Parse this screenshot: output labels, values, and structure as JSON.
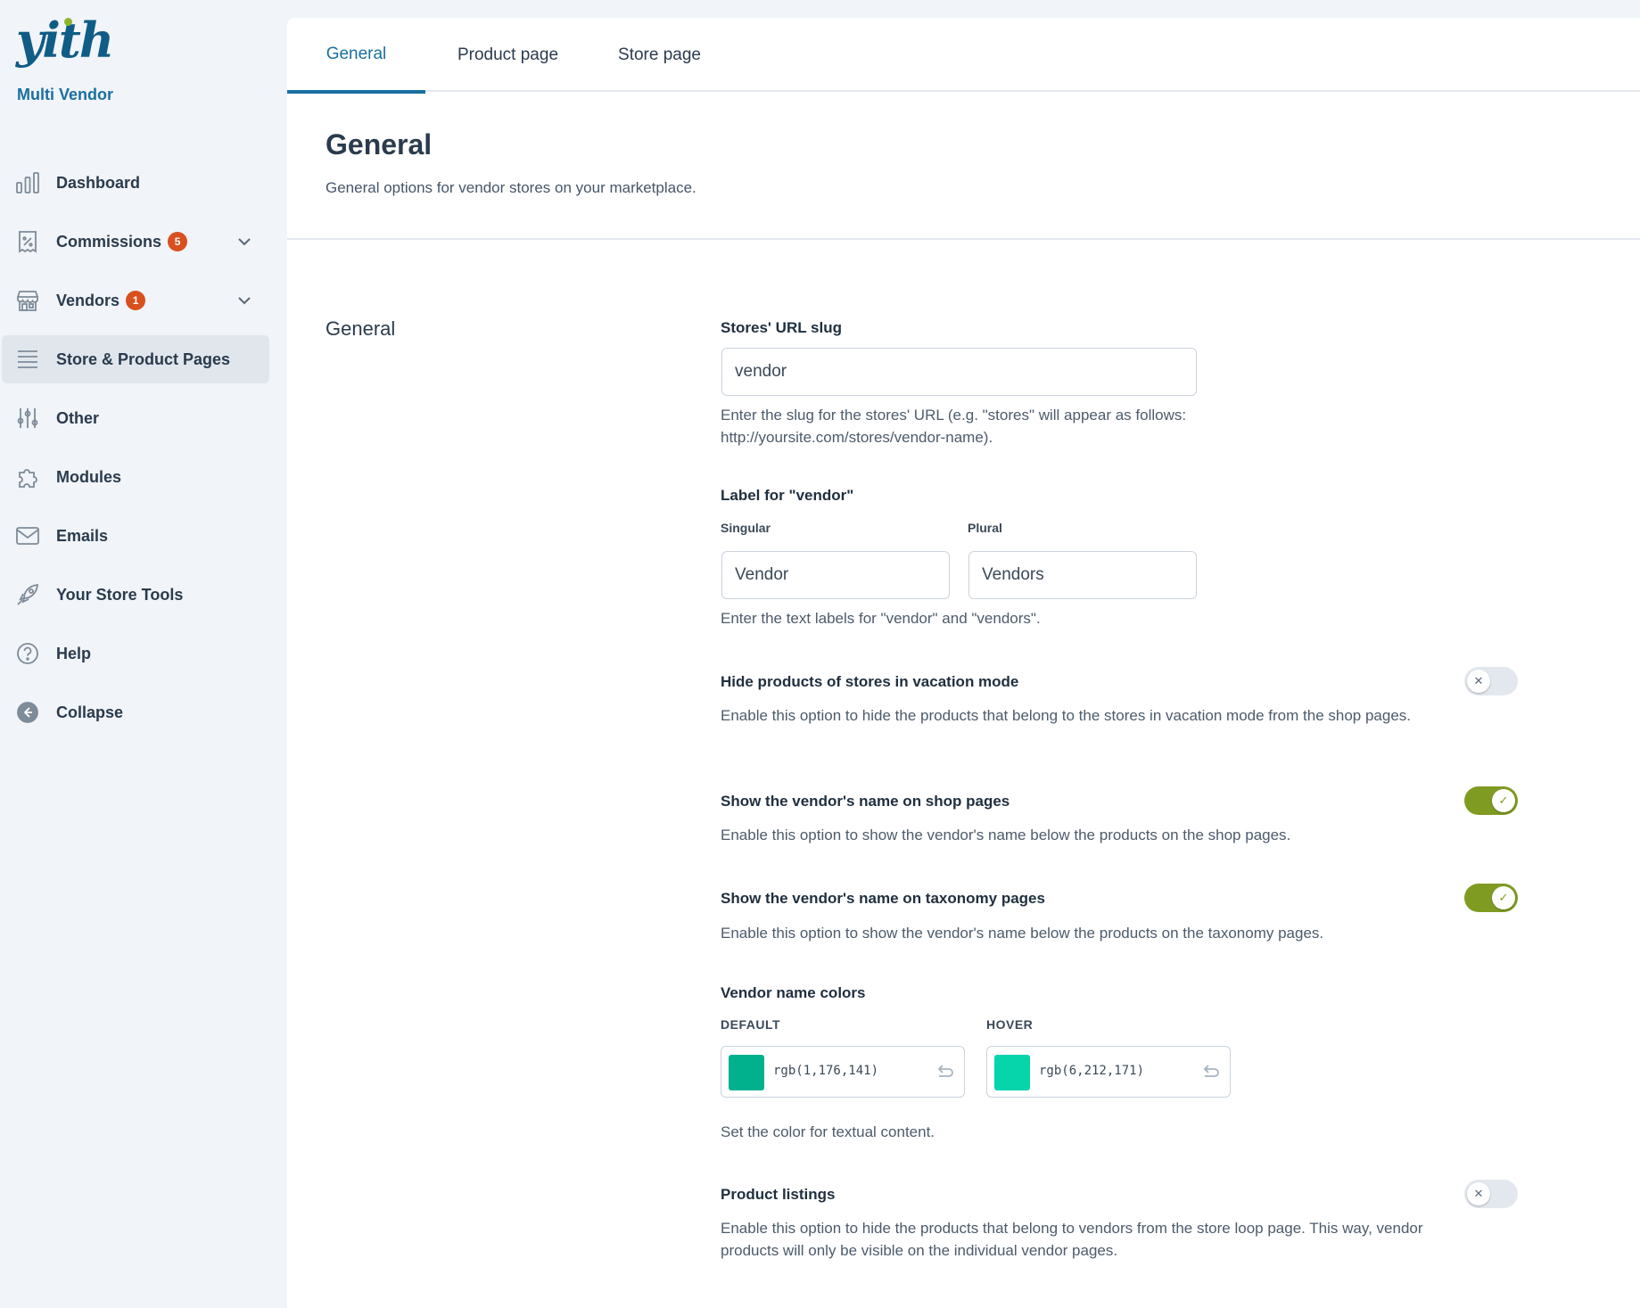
{
  "brand": {
    "logo_text": "yith",
    "subtitle": "Multi Vendor"
  },
  "sidebar": {
    "items": [
      {
        "label": "Dashboard",
        "icon": "bar-chart-icon"
      },
      {
        "label": "Commissions",
        "icon": "receipt-percent-icon",
        "badge": "5"
      },
      {
        "label": "Vendors",
        "icon": "storefront-icon",
        "badge": "1"
      },
      {
        "label": "Store & Product Pages",
        "icon": "list-lines-icon"
      },
      {
        "label": "Other",
        "icon": "sliders-icon"
      },
      {
        "label": "Modules",
        "icon": "puzzle-icon"
      },
      {
        "label": "Emails",
        "icon": "envelope-icon"
      },
      {
        "label": "Your Store Tools",
        "icon": "rocket-icon"
      },
      {
        "label": "Help",
        "icon": "question-circle-icon"
      },
      {
        "label": "Collapse",
        "icon": "arrow-left-circle-icon"
      }
    ]
  },
  "tabs": [
    {
      "label": "General"
    },
    {
      "label": "Product page"
    },
    {
      "label": "Store page"
    }
  ],
  "page": {
    "title": "General",
    "description": "General options for vendor stores on your marketplace."
  },
  "section": {
    "label": "General",
    "slug": {
      "title": "Stores' URL slug",
      "value": "vendor",
      "description": "Enter the slug for the stores' URL (e.g. \"stores\" will appear as follows: http://yoursite.com/stores/vendor-name)."
    },
    "vendor_label": {
      "title": "Label for \"vendor\"",
      "singular_label": "Singular",
      "singular_value": "Vendor",
      "plural_label": "Plural",
      "plural_value": "Vendors",
      "description": "Enter the text labels for \"vendor\" and \"vendors\"."
    },
    "vacation": {
      "title": "Hide products of stores in vacation mode",
      "description": "Enable this option to hide the products that belong to the stores in vacation mode from the shop pages.",
      "enabled": false
    },
    "shop_name": {
      "title": "Show the vendor's name on shop pages",
      "description": "Enable this option to show the vendor's name below the products on the shop pages.",
      "enabled": true
    },
    "taxonomy_name": {
      "title": "Show the vendor's name on taxonomy pages",
      "description": "Enable this option to show the vendor's name below the products on the taxonomy pages.",
      "enabled": true
    },
    "colors": {
      "title": "Vendor name colors",
      "default_label": "DEFAULT",
      "default_value": "rgb(1,176,141)",
      "default_hex": "#01b08d",
      "hover_label": "HOVER",
      "hover_value": "rgb(6,212,171)",
      "hover_hex": "#06d4ab",
      "description": "Set the color for textual content."
    },
    "listings": {
      "title": "Product listings",
      "description": "Enable this option to hide the products that belong to vendors from the store loop page. This way, vendor products will only be visible on the individual vendor pages.",
      "enabled": false
    }
  },
  "theme": {
    "accent": "#1a6fa0",
    "toggle_on": "#7f9b22",
    "badge": "#d94f1e"
  }
}
